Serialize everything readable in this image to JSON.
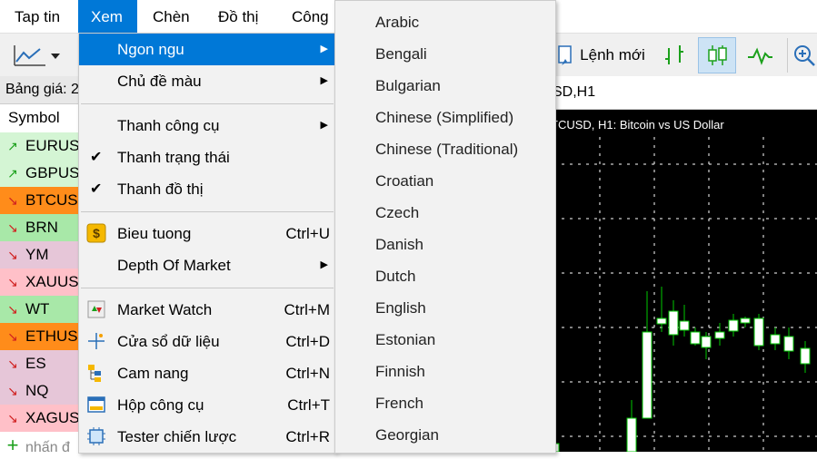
{
  "menubar": {
    "items": [
      "Tap tin",
      "Xem",
      "Chèn",
      "Đồ thị",
      "Công"
    ]
  },
  "toolbar": {
    "new_order_label": "Lệnh mới"
  },
  "market_watch": {
    "header": "Bảng giá: 2",
    "column_symbol": "Symbol",
    "rows": [
      {
        "symbol": "EURUS",
        "dir": "up",
        "bg": "#d4f5d4"
      },
      {
        "symbol": "GBPUS",
        "dir": "up",
        "bg": "#d4f5d4"
      },
      {
        "symbol": "BTCUS",
        "dir": "down",
        "bg": "#ff8c1a"
      },
      {
        "symbol": "BRN",
        "dir": "down",
        "bg": "#a8e8a8"
      },
      {
        "symbol": "YM",
        "dir": "down",
        "bg": "#e6c6d8"
      },
      {
        "symbol": "XAUUS",
        "dir": "down",
        "bg": "#ffc0c8"
      },
      {
        "symbol": "WT",
        "dir": "down",
        "bg": "#a8e8a8"
      },
      {
        "symbol": "ETHUS",
        "dir": "down",
        "bg": "#ff8c1a"
      },
      {
        "symbol": "ES",
        "dir": "down",
        "bg": "#e6c6d8"
      },
      {
        "symbol": "NQ",
        "dir": "down",
        "bg": "#e6c6d8"
      },
      {
        "symbol": "XAGUS",
        "dir": "down",
        "bg": "#ffc0c8"
      }
    ],
    "add_symbol": "nhấn đ"
  },
  "chart": {
    "tab_title": "SD,H1",
    "label": "TCUSD, H1:  Bitcoin vs US Dollar"
  },
  "view_menu": {
    "items": [
      {
        "label": "Ngon ngu",
        "shortcut": "",
        "submenu": true,
        "checked": false,
        "icon": ""
      },
      {
        "label": "Chủ đề màu",
        "shortcut": "",
        "submenu": true,
        "checked": false,
        "icon": ""
      },
      {
        "label": "Thanh công cụ",
        "shortcut": "",
        "submenu": true,
        "checked": false,
        "icon": ""
      },
      {
        "label": "Thanh trạng thái",
        "shortcut": "",
        "submenu": false,
        "checked": true,
        "icon": ""
      },
      {
        "label": "Thanh đồ thị",
        "shortcut": "",
        "submenu": false,
        "checked": true,
        "icon": ""
      },
      {
        "label": "Bieu tuong",
        "shortcut": "Ctrl+U",
        "submenu": false,
        "checked": false,
        "icon": "dollar-symbol-icon"
      },
      {
        "label": "Depth Of Market",
        "shortcut": "",
        "submenu": true,
        "checked": false,
        "icon": ""
      },
      {
        "label": "Market Watch",
        "shortcut": "Ctrl+M",
        "submenu": false,
        "checked": false,
        "icon": "market-watch-icon"
      },
      {
        "label": "Cửa sổ dữ liệu",
        "shortcut": "Ctrl+D",
        "submenu": false,
        "checked": false,
        "icon": "data-window-icon"
      },
      {
        "label": "Cam nang",
        "shortcut": "Ctrl+N",
        "submenu": false,
        "checked": false,
        "icon": "navigator-icon"
      },
      {
        "label": "Hộp công cụ",
        "shortcut": "Ctrl+T",
        "submenu": false,
        "checked": false,
        "icon": "toolbox-icon"
      },
      {
        "label": "Tester chiến lược",
        "shortcut": "Ctrl+R",
        "submenu": false,
        "checked": false,
        "icon": "strategy-tester-icon"
      }
    ]
  },
  "language_submenu": {
    "items": [
      "Arabic",
      "Bengali",
      "Bulgarian",
      "Chinese (Simplified)",
      "Chinese (Traditional)",
      "Croatian",
      "Czech",
      "Danish",
      "Dutch",
      "English",
      "Estonian",
      "Finnish",
      "French",
      "Georgian"
    ]
  },
  "colors": {
    "accent": "#0078d7",
    "menu_bg": "#f2f2f2",
    "bull": "#00c800",
    "chart_bg": "#000000"
  }
}
